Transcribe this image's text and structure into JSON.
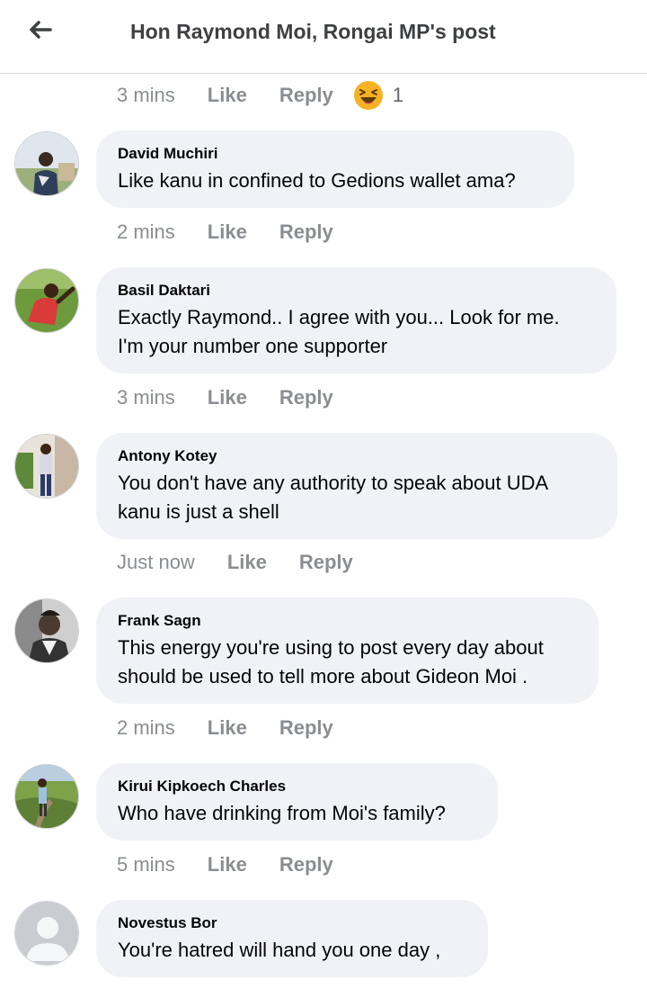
{
  "header": {
    "title": "Hon Raymond Moi, Rongai MP's post"
  },
  "top_meta": {
    "time": "3 mins",
    "like": "Like",
    "reply": "Reply",
    "reaction_count": "1"
  },
  "comments": [
    {
      "name": "David Muchiri",
      "text": "Like kanu in confined to Gedions wallet ama?",
      "time": "2 mins",
      "like": "Like",
      "reply": "Reply"
    },
    {
      "name": "Basil Daktari",
      "text": "Exactly Raymond.. I agree with you... Look for me.\nI'm your number one supporter",
      "time": "3 mins",
      "like": "Like",
      "reply": "Reply"
    },
    {
      "name": "Antony Kotey",
      "text": "You don't have any authority  to speak about  UDA\nkanu is just a shell",
      "time": "Just now",
      "like": "Like",
      "reply": "Reply"
    },
    {
      "name": "Frank Sagn",
      "text": "This energy you're using to post every day about\nshould be used to tell more about Gideon Moi .",
      "time": "2 mins",
      "like": "Like",
      "reply": "Reply"
    },
    {
      "name": "Kirui Kipkoech Charles",
      "text": "Who have drinking from Moi's family?",
      "time": "5 mins",
      "like": "Like",
      "reply": "Reply"
    },
    {
      "name": "Novestus Bor",
      "text": "You're hatred will hand you one day ,",
      "time": "",
      "like": "",
      "reply": ""
    }
  ],
  "colors": {
    "bubble": "#f0f2f5",
    "meta_text": "#8a8d91",
    "divider": "#d8dadf"
  },
  "icons": {
    "back": "back-arrow-icon",
    "reaction": "haha-reaction-icon"
  }
}
